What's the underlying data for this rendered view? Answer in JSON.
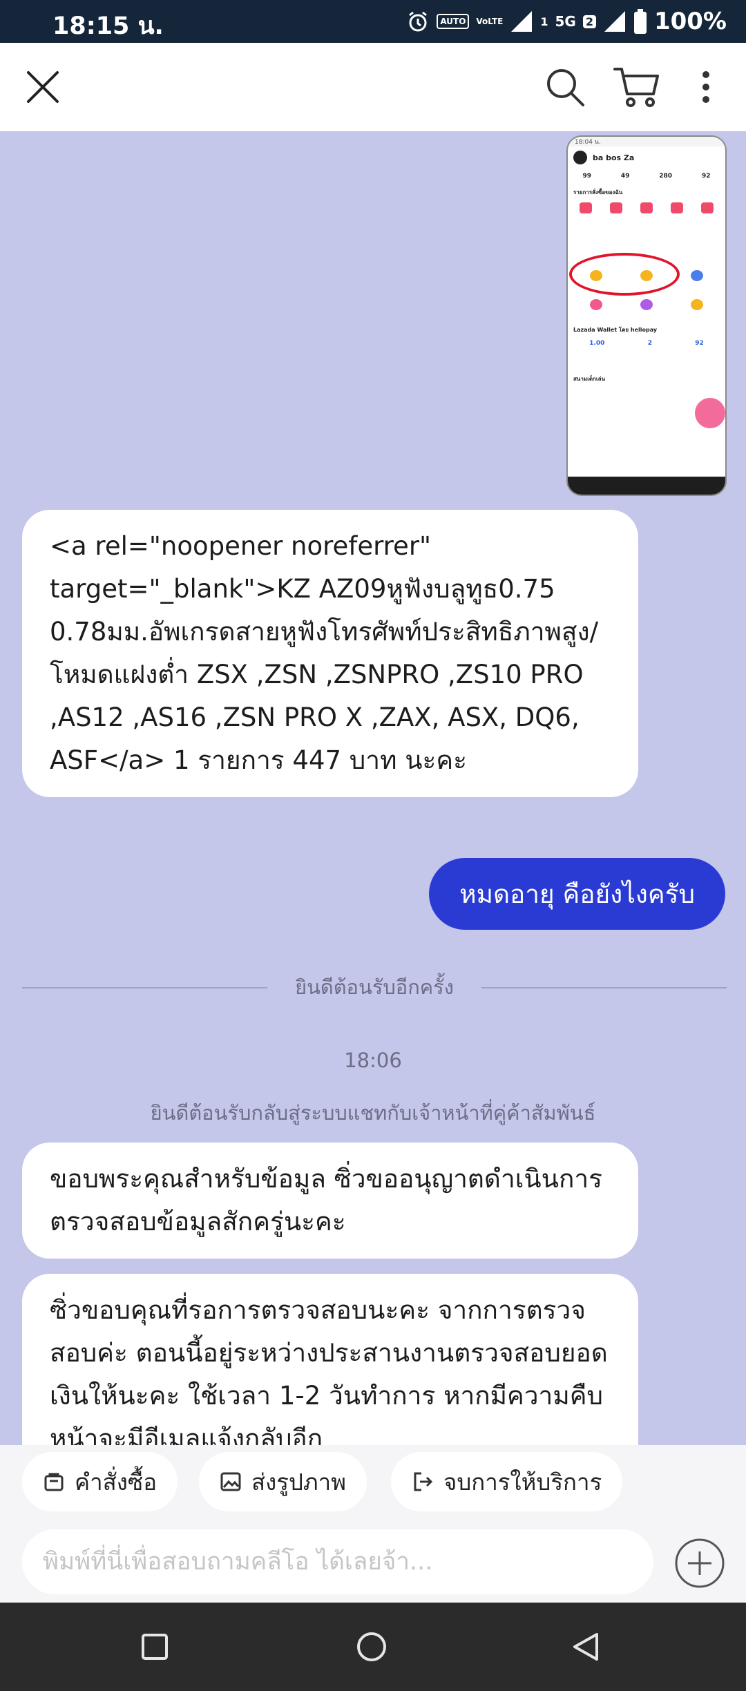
{
  "status_bar": {
    "time": "18:15 น.",
    "auto_label": "AUTO",
    "volte_label": "VoLTE",
    "sim1_badge": "1",
    "network_label": "5G",
    "sim2_badge": "2",
    "battery_percent": "100%"
  },
  "toolbar": {
    "icons": [
      "close-icon",
      "search-icon",
      "cart-icon",
      "more-vert-icon"
    ]
  },
  "thumbnail": {
    "status_text": "18:04 น.",
    "profile_name": "ba bos Za",
    "stats": [
      "99",
      "49",
      "280",
      "92"
    ],
    "section_title": "รายการสั่งซื้อของฉัน",
    "wallet_title": "Lazada Wallet โดย hellopay",
    "wallet_values": [
      "1.00",
      "2",
      "92"
    ],
    "bottom_section": "สนามเด็กเล่น"
  },
  "messages": {
    "order_link": "<a rel=\"noopener noreferrer\" target=\"_blank\">KZ AZ09หูฟังบลูทูธ0.75 0.78มม.อัพเกรดสายหูฟังโทรศัพท์ประสิทธิภาพสูง/โหมดแฝงต่ำ ZSX ,ZSN ,ZSNPRO ,ZS10 PRO ,AS12 ,AS16 ,ZSN PRO X ,ZAX, ASX, DQ6, ASF</a> 1 รายการ 447 บาท นะคะ",
    "user_question": "หมดอายุ คือยังไงครับ",
    "divider_text": "ยินดีต้อนรับอีกครั้ง",
    "time_stamp": "18:06",
    "system_message": "ยินดีต้อนรับกลับสู่ระบบแชทกับเจ้าหน้าที่คู่ค้าสัมพันธ์",
    "agent_reply_1": "ขอบพระคุณสำหรับข้อมูล ซิ่วขออนุญาตดำเนินการตรวจสอบข้อมูลสักครู่นะคะ",
    "agent_reply_2": "ซิ่วขอบคุณที่รอการตรวจสอบนะคะ  จากการตรวจสอบค่ะ ตอนนี้อยู่ระหว่างประสานงานตรวจสอบยอดเงินให้นะคะ ใช้เวลา 1-2 วันทำการ หากมีความคืบหน้าจะมีอีเมลแจ้งกลับอีก"
  },
  "quick_actions": {
    "orders": "คำสั่งซื้อ",
    "send_image": "ส่งรูปภาพ",
    "end_service": "จบการให้บริการ"
  },
  "composer": {
    "placeholder": "พิมพ์ที่นี่เพื่อสอบถามคลีโอ ได้เลยจ้า..."
  }
}
